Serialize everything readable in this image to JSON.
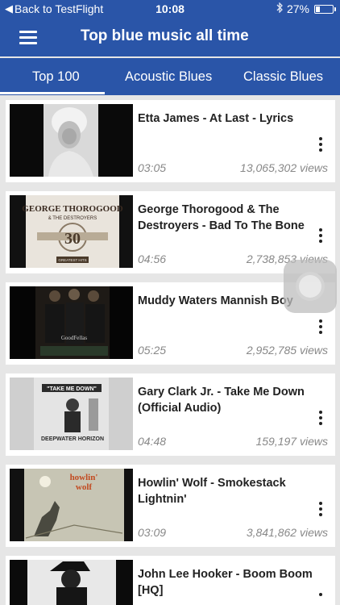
{
  "status_bar": {
    "back_label": "Back to TestFlight",
    "time": "10:08",
    "battery": "27%",
    "battery_level": 0.27,
    "icons": [
      "bluetooth-icon",
      "battery-icon"
    ]
  },
  "nav": {
    "title": "Top blue music all time",
    "menu_icon": "hamburger-icon"
  },
  "tabs": [
    {
      "label": "Top 100",
      "active": true
    },
    {
      "label": "Acoustic Blues",
      "active": false
    },
    {
      "label": "Classic Blues",
      "active": false
    }
  ],
  "videos": [
    {
      "title": "Etta James - At Last - Lyrics",
      "duration": "03:05",
      "views": "13,065,302 views"
    },
    {
      "title": "George Thorogood & The Destroyers - Bad To The Bone",
      "duration": "04:56",
      "views": "2,738,853 views",
      "thumb_text": {
        "band": "GEORGE THOROGOOD",
        "sub": "& THE DESTROYERS",
        "number": "30",
        "badge": "GREATEST HITS"
      }
    },
    {
      "title": "Muddy Waters Mannish Boy",
      "duration": "05:25",
      "views": "2,952,785 views",
      "thumb_text": {
        "logo": "GoodFellas"
      }
    },
    {
      "title": "Gary Clark Jr. - Take Me Down (Official Audio)",
      "duration": "04:48",
      "views": "159,197 views",
      "thumb_text": {
        "banner": "\"TAKE ME DOWN\"",
        "footer": "DEEPWATER HORIZON"
      }
    },
    {
      "title": "Howlin' Wolf - Smokestack Lightnin'",
      "duration": "03:09",
      "views": "3,841,862 views",
      "thumb_text": {
        "logo_line1": "howlin'",
        "logo_line2": "wolf"
      }
    },
    {
      "title": "John Lee Hooker - Boom Boom [HQ]",
      "duration": "",
      "views": ""
    }
  ],
  "colors": {
    "header_blue": "#2a55a8",
    "background": "#e6e6e6",
    "card": "#ffffff",
    "meta_text": "#888888"
  }
}
